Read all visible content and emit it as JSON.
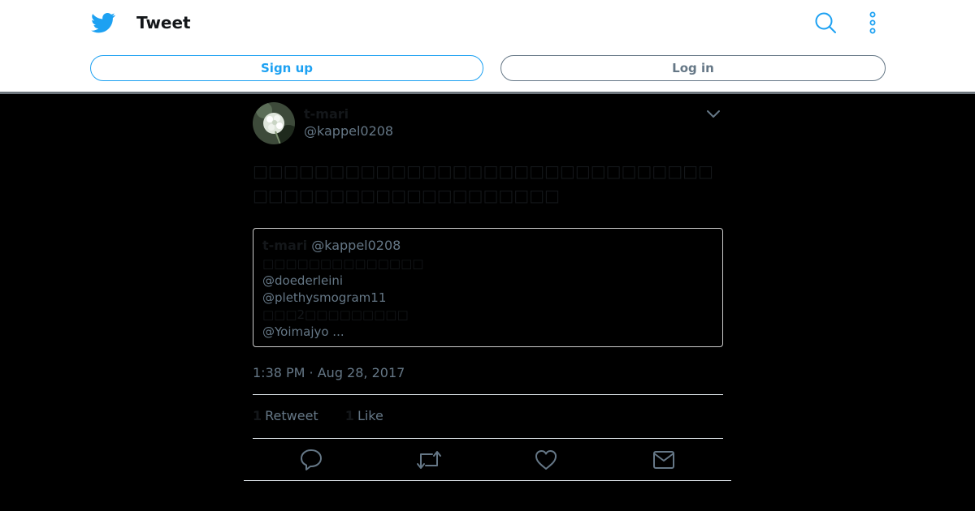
{
  "header": {
    "title": "Tweet",
    "logo_icon": "twitter-bird-icon",
    "search_icon": "search-icon",
    "more_icon": "more-vertical-icon",
    "signup_label": "Sign up",
    "login_label": "Log in"
  },
  "colors": {
    "brand": "#1da1f2",
    "secondary_text": "#657786",
    "background": "#000000"
  },
  "tweet": {
    "author_name": "t-mari",
    "author_handle": "@kappel0208",
    "text": "□□□□□□□□□□□□□□□□□□□□□□□□□□□□□□□□□□□□□□□□□□□□□□□□□□",
    "quoted": {
      "author_name": "t-mari",
      "author_handle": "@kappel0208",
      "lines": [
        "□□□□□□□□□□□□□□",
        "@doederleini",
        "@plethysmogram11",
        "□□□2□□□□□□□□□",
        "@Yoimajyo ..."
      ]
    },
    "timestamp": "1:38 PM · Aug 28, 2017",
    "stats": {
      "retweet_count": "1",
      "retweet_label": "Retweet",
      "like_count": "1",
      "like_label": "Like"
    },
    "actions": [
      "reply-icon",
      "retweet-icon",
      "like-icon",
      "message-icon"
    ]
  }
}
